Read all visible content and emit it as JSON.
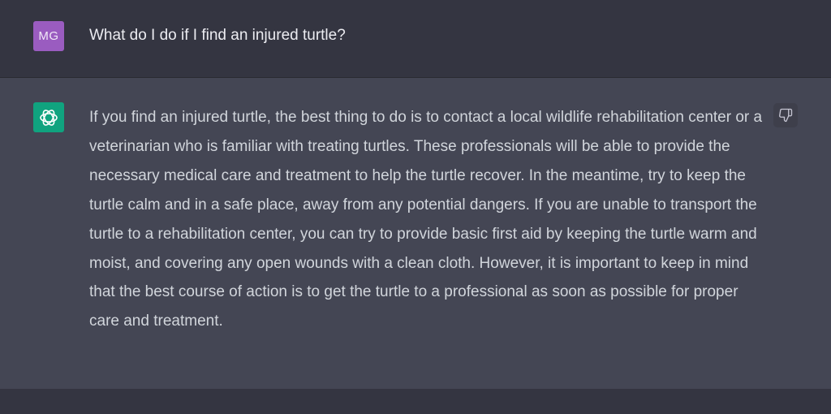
{
  "user_message": {
    "avatar_initials": "MG",
    "text": "What do I do if I find an injured turtle?"
  },
  "assistant_message": {
    "text": "If you find an injured turtle, the best thing to do is to contact a local wildlife rehabilitation center or a veterinarian who is familiar with treating turtles. These professionals will be able to provide the necessary medical care and treatment to help the turtle recover. In the meantime, try to keep the turtle calm and in a safe place, away from any potential dangers. If you are unable to transport the turtle to a rehabilitation center, you can try to provide basic first aid by keeping the turtle warm and moist, and covering any open wounds with a clean cloth. However, it is important to keep in mind that the best course of action is to get the turtle to a professional as soon as possible for proper care and treatment."
  },
  "icons": {
    "assistant_avatar": "openai-logo-icon",
    "feedback": "thumbs-down-icon"
  },
  "colors": {
    "user_bg": "#343541",
    "assistant_bg": "#444654",
    "user_avatar": "#9a5cc0",
    "assistant_avatar": "#10a37f"
  }
}
